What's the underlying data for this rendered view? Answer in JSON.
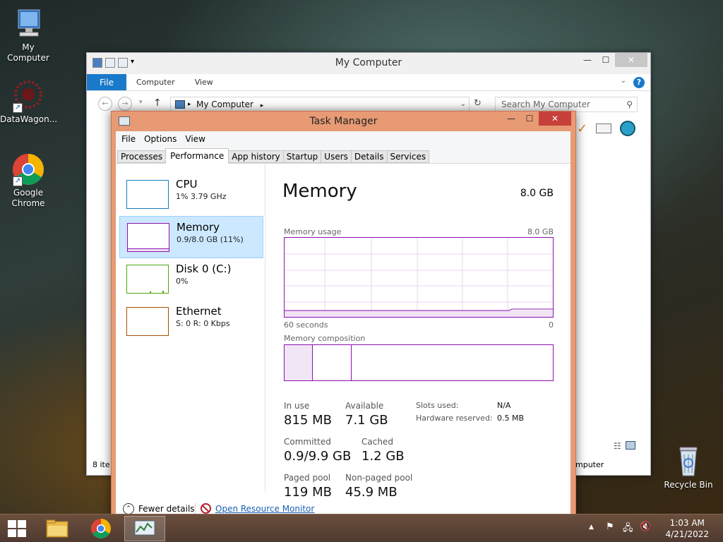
{
  "desktop": {
    "icons": [
      {
        "label": "My Computer"
      },
      {
        "label": "DataWagon..."
      },
      {
        "label": "Google Chrome"
      },
      {
        "label": "Recycle Bin"
      }
    ]
  },
  "explorer": {
    "title": "My Computer",
    "ribbon_tabs": [
      "File",
      "Computer",
      "View"
    ],
    "address": "My Computer",
    "search_placeholder": "Search My Computer",
    "status_left": "8 ite",
    "status_right": "mputer"
  },
  "taskmgr": {
    "title": "Task Manager",
    "menu": [
      "File",
      "Options",
      "View"
    ],
    "tabs": [
      "Processes",
      "Performance",
      "App history",
      "Startup",
      "Users",
      "Details",
      "Services"
    ],
    "active_tab": "Performance",
    "sidebar": [
      {
        "title": "CPU",
        "sub": "1% 3.79 GHz"
      },
      {
        "title": "Memory",
        "sub": "0.9/8.0 GB (11%)"
      },
      {
        "title": "Disk 0 (C:)",
        "sub": "0%"
      },
      {
        "title": "Ethernet",
        "sub": "S: 0 R: 0 Kbps"
      }
    ],
    "main": {
      "title": "Memory",
      "total": "8.0 GB",
      "usage_label": "Memory usage",
      "usage_max": "8.0 GB",
      "time_span": "60 seconds",
      "time_zero": "0",
      "composition_label": "Memory composition",
      "in_use_label": "In use",
      "in_use_value": "815 MB",
      "available_label": "Available",
      "available_value": "7.1 GB",
      "committed_label": "Committed",
      "committed_value": "0.9/9.9 GB",
      "cached_label": "Cached",
      "cached_value": "1.2 GB",
      "paged_label": "Paged pool",
      "paged_value": "119 MB",
      "nonpaged_label": "Non-paged pool",
      "nonpaged_value": "45.9 MB",
      "slots_label": "Slots used:",
      "slots_value": "N/A",
      "hw_label": "Hardware reserved:",
      "hw_value": "0.5 MB"
    },
    "footer": {
      "fewer": "Fewer details",
      "monitor": "Open Resource Monitor"
    }
  },
  "taskbar": {
    "time": "1:03 AM",
    "date": "4/21/2022"
  },
  "colors": {
    "memory_accent": "#8b12ae",
    "cpu_accent": "#117dbb",
    "disk_accent": "#4da60c",
    "ethernet_accent": "#a74f01",
    "taskmgr_frame": "#e79a74"
  }
}
